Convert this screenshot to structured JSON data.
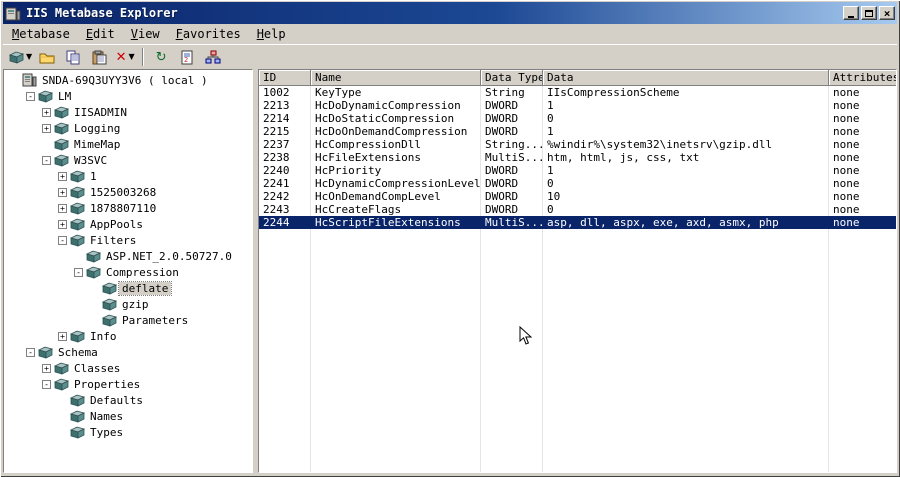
{
  "window": {
    "title": "IIS Metabase Explorer"
  },
  "menu": {
    "items": [
      {
        "label": "Metabase"
      },
      {
        "label": "Edit"
      },
      {
        "label": "View"
      },
      {
        "label": "Favorites"
      },
      {
        "label": "Help"
      }
    ]
  },
  "toolbar": {
    "buttons": [
      {
        "name": "new-key-button",
        "icon": "key-icon",
        "dropdown": true
      },
      {
        "name": "open-button",
        "icon": "folder-icon"
      },
      {
        "name": "copy-button",
        "icon": "copy-icon"
      },
      {
        "name": "paste-button",
        "icon": "paste-icon"
      },
      {
        "name": "delete-button",
        "icon": "delete-x-icon",
        "dropdown": true
      },
      {
        "separator": true
      },
      {
        "name": "refresh-button",
        "icon": "refresh-icon"
      },
      {
        "name": "export-button",
        "icon": "export-icon"
      },
      {
        "name": "connections-button",
        "icon": "network-icon"
      }
    ]
  },
  "tree": {
    "items": [
      {
        "depth": 0,
        "expander": "none",
        "icon": "computer",
        "label": "SNDA-69Q3UYY3V6 ( local )"
      },
      {
        "depth": 1,
        "expander": "minus",
        "icon": "key",
        "label": "LM"
      },
      {
        "depth": 2,
        "expander": "plus",
        "icon": "key",
        "label": "IISADMIN"
      },
      {
        "depth": 2,
        "expander": "plus",
        "icon": "key",
        "label": "Logging"
      },
      {
        "depth": 2,
        "expander": "none",
        "icon": "key",
        "label": "MimeMap"
      },
      {
        "depth": 2,
        "expander": "minus",
        "icon": "key",
        "label": "W3SVC"
      },
      {
        "depth": 3,
        "expander": "plus",
        "icon": "key",
        "label": "1"
      },
      {
        "depth": 3,
        "expander": "plus",
        "icon": "key",
        "label": "1525003268"
      },
      {
        "depth": 3,
        "expander": "plus",
        "icon": "key",
        "label": "1878807110"
      },
      {
        "depth": 3,
        "expander": "plus",
        "icon": "key",
        "label": "AppPools"
      },
      {
        "depth": 3,
        "expander": "minus",
        "icon": "key",
        "label": "Filters"
      },
      {
        "depth": 4,
        "expander": "none",
        "icon": "key",
        "label": "ASP.NET_2.0.50727.0"
      },
      {
        "depth": 4,
        "expander": "minus",
        "icon": "key",
        "label": "Compression"
      },
      {
        "depth": 5,
        "expander": "none",
        "icon": "key",
        "label": "deflate",
        "selected": true
      },
      {
        "depth": 5,
        "expander": "none",
        "icon": "key",
        "label": "gzip"
      },
      {
        "depth": 5,
        "expander": "none",
        "icon": "key",
        "label": "Parameters"
      },
      {
        "depth": 3,
        "expander": "plus",
        "icon": "key",
        "label": "Info"
      },
      {
        "depth": 1,
        "expander": "minus",
        "icon": "key",
        "label": "Schema"
      },
      {
        "depth": 2,
        "expander": "plus",
        "icon": "key",
        "label": "Classes"
      },
      {
        "depth": 2,
        "expander": "minus",
        "icon": "key",
        "label": "Properties"
      },
      {
        "depth": 3,
        "expander": "none",
        "icon": "key",
        "label": "Defaults"
      },
      {
        "depth": 3,
        "expander": "none",
        "icon": "key",
        "label": "Names"
      },
      {
        "depth": 3,
        "expander": "none",
        "icon": "key",
        "label": "Types"
      }
    ]
  },
  "table": {
    "columns": [
      "ID",
      "Name",
      "Data Type",
      "Data",
      "Attributes"
    ],
    "selected_index": 10,
    "rows": [
      {
        "id": "1002",
        "name": "KeyType",
        "data_type": "String",
        "data": "IIsCompressionScheme",
        "attributes": "none"
      },
      {
        "id": "2213",
        "name": "HcDoDynamicCompression",
        "data_type": "DWORD",
        "data": "1",
        "attributes": "none"
      },
      {
        "id": "2214",
        "name": "HcDoStaticCompression",
        "data_type": "DWORD",
        "data": "0",
        "attributes": "none"
      },
      {
        "id": "2215",
        "name": "HcDoOnDemandCompression",
        "data_type": "DWORD",
        "data": "1",
        "attributes": "none"
      },
      {
        "id": "2237",
        "name": "HcCompressionDll",
        "data_type": "String...",
        "data": "%windir%\\system32\\inetsrv\\gzip.dll",
        "attributes": "none"
      },
      {
        "id": "2238",
        "name": "HcFileExtensions",
        "data_type": "MultiS...",
        "data": "htm, html, js, css, txt",
        "attributes": "none"
      },
      {
        "id": "2240",
        "name": "HcPriority",
        "data_type": "DWORD",
        "data": "1",
        "attributes": "none"
      },
      {
        "id": "2241",
        "name": "HcDynamicCompressionLevel",
        "data_type": "DWORD",
        "data": "0",
        "attributes": "none"
      },
      {
        "id": "2242",
        "name": "HcOnDemandCompLevel",
        "data_type": "DWORD",
        "data": "10",
        "attributes": "none"
      },
      {
        "id": "2243",
        "name": "HcCreateFlags",
        "data_type": "DWORD",
        "data": "0",
        "attributes": "none"
      },
      {
        "id": "2244",
        "name": "HcScriptFileExtensions",
        "data_type": "MultiS...",
        "data": "asp, dll, aspx, exe, axd, asmx, php",
        "attributes": "none"
      }
    ]
  },
  "colors": {
    "titlebar_start": "#0a246a",
    "titlebar_end": "#a6caf0",
    "chrome": "#d4d0c8",
    "selection": "#0a246a",
    "selection_text": "#ffffff"
  }
}
